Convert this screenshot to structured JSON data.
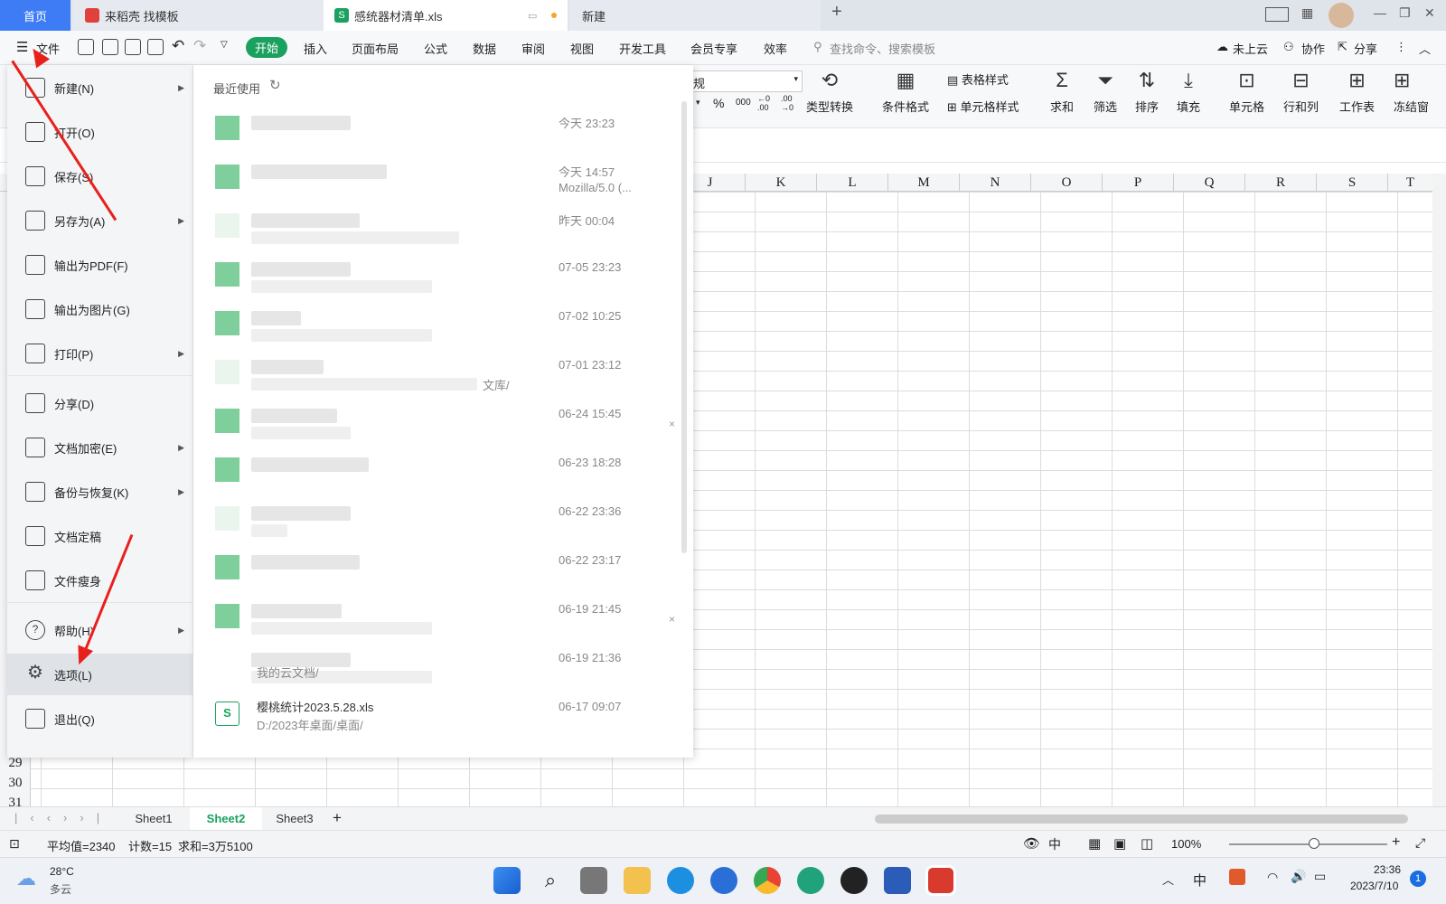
{
  "titlebar": {
    "tab_home": "首页",
    "tab_template": "来稻壳 找模板",
    "tab_doc": "感统器材清单.xls",
    "tab_new": "新建",
    "add": "+"
  },
  "menubar": {
    "file": "文件",
    "items": [
      "开始",
      "插入",
      "页面布局",
      "公式",
      "数据",
      "审阅",
      "视图",
      "开发工具",
      "会员专享",
      "效率"
    ],
    "search_placeholder": "查找命令、搜索模板",
    "cloud": "未上云",
    "collab": "协作",
    "share": "分享"
  },
  "ribbon": {
    "numfmt": "规",
    "type_convert": "类型转换",
    "cond_format": "条件格式",
    "table_style": "表格样式",
    "cell_style": "单元格样式",
    "sum": "求和",
    "filter": "筛选",
    "sort": "排序",
    "fill": "填充",
    "cell": "单元格",
    "rowcol": "行和列",
    "sheet": "工作表",
    "freeze": "冻结窗",
    "percent": "%",
    "thousand": "000",
    "dec_inc": "←0 .00",
    "dec_dec": ".00 →0"
  },
  "columns": [
    "J",
    "K",
    "L",
    "M",
    "N",
    "O",
    "P",
    "Q",
    "R",
    "S",
    "T"
  ],
  "rows": [
    "29",
    "30",
    "31"
  ],
  "file_menu": [
    {
      "label": "新建(N)",
      "icon": "new-file-icon",
      "arrow": true
    },
    {
      "label": "打开(O)",
      "icon": "folder-open-icon",
      "arrow": false
    },
    {
      "label": "保存(S)",
      "icon": "save-icon",
      "arrow": false
    },
    {
      "label": "另存为(A)",
      "icon": "save-as-icon",
      "arrow": true
    },
    {
      "label": "输出为PDF(F)",
      "icon": "pdf-export-icon",
      "arrow": false
    },
    {
      "label": "输出为图片(G)",
      "icon": "image-export-icon",
      "arrow": false
    },
    {
      "label": "打印(P)",
      "icon": "print-icon",
      "arrow": true
    },
    {
      "label": "分享(D)",
      "icon": "share-icon",
      "arrow": false
    },
    {
      "label": "文档加密(E)",
      "icon": "lock-doc-icon",
      "arrow": true
    },
    {
      "label": "备份与恢复(K)",
      "icon": "backup-icon",
      "arrow": true
    },
    {
      "label": "文档定稿",
      "icon": "finalize-icon",
      "arrow": false
    },
    {
      "label": "文件瘦身",
      "icon": "slim-icon",
      "arrow": false
    },
    {
      "label": "帮助(H)",
      "icon": "help-icon",
      "arrow": true
    },
    {
      "label": "选项(L)",
      "icon": "gear-icon",
      "arrow": false
    },
    {
      "label": "退出(Q)",
      "icon": "exit-icon",
      "arrow": false
    }
  ],
  "recent": {
    "header": "最近使用",
    "items": [
      {
        "time": "今天 23:23",
        "path": ""
      },
      {
        "time": "今天 14:57",
        "path": "Mozilla/5.0 (..."
      },
      {
        "time": "昨天 00:04",
        "path": ""
      },
      {
        "time": "07-05 23:23",
        "path": ""
      },
      {
        "time": "07-02 10:25",
        "path": ""
      },
      {
        "time": "07-01 23:12",
        "path": "",
        "tail": "文库/"
      },
      {
        "time": "06-24 15:45",
        "path": ""
      },
      {
        "time": "06-23 18:28",
        "path": ""
      },
      {
        "time": "06-22 23:36",
        "path": ""
      },
      {
        "time": "06-22 23:17",
        "path": ""
      },
      {
        "time": "06-19 21:45",
        "path": ""
      },
      {
        "time": "06-19 21:36",
        "path": "",
        "sub": "我的云文档/"
      },
      {
        "time": "06-17 09:07",
        "name": "樱桃统计2023.5.28.xls",
        "sub": "D:/2023年桌面/桌面/"
      }
    ]
  },
  "sheets": [
    "Sheet1",
    "Sheet2",
    "Sheet3"
  ],
  "status": {
    "avg": "平均值=2340",
    "count": "计数=15",
    "sum": "求和=3万5100",
    "zoom": "100%"
  },
  "taskbar": {
    "temp": "28°C",
    "weather": "多云",
    "ime": "中",
    "time": "23:36",
    "date": "2023/7/10",
    "badge": "1"
  },
  "colors": {
    "accent": "#1aa15f",
    "home_tab": "#3d7cf4",
    "arrow": "#e8201c"
  }
}
